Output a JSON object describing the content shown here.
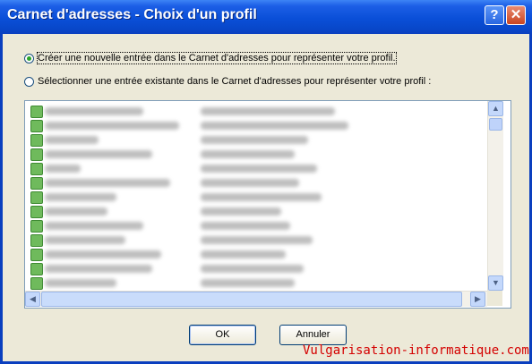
{
  "window": {
    "title": "Carnet d'adresses - Choix d'un profil",
    "help_glyph": "?",
    "close_glyph": "✕"
  },
  "options": [
    {
      "label": "Créer une nouvelle entrée dans le Carnet d'adresses pour représenter votre profil.",
      "selected": true
    },
    {
      "label": "Sélectionner une entrée existante dans le Carnet d'adresses pour représenter votre profil :",
      "selected": false
    }
  ],
  "contacts_list": {
    "row_count": 13,
    "contents_blurred": true
  },
  "scrollbar": {
    "up": "▲",
    "down": "▼",
    "left": "◀",
    "right": "▶"
  },
  "buttons": {
    "ok": "OK",
    "cancel": "Annuler"
  },
  "watermark": "Vulgarisation-informatique.com",
  "colors": {
    "titlebar": "#0a4fd8",
    "dialog_bg": "#ece9d8",
    "watermark": "#d40000"
  }
}
